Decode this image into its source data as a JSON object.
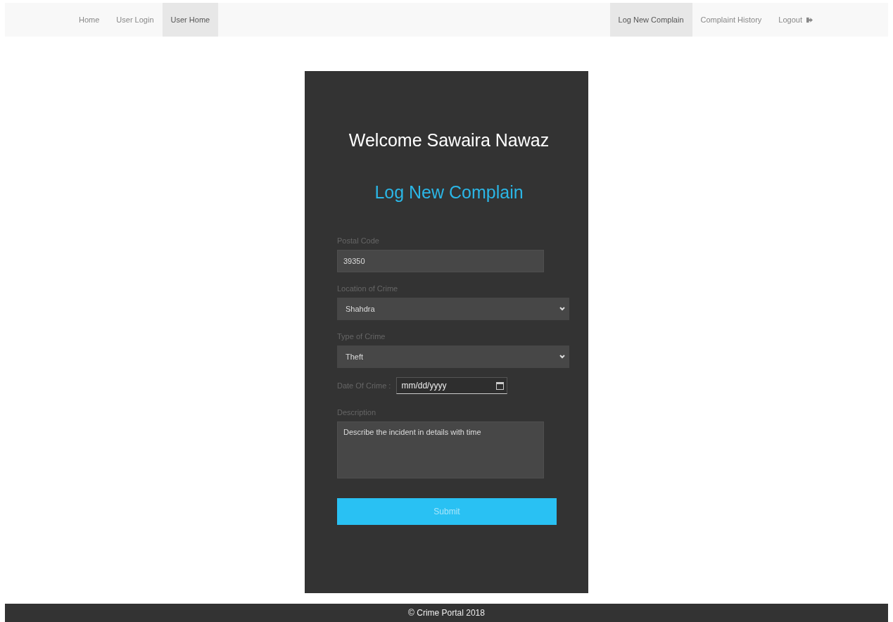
{
  "nav": {
    "left": [
      {
        "label": "Home",
        "selected": false
      },
      {
        "label": "User Login",
        "selected": false
      },
      {
        "label": "User Home",
        "selected": true
      }
    ],
    "right": [
      {
        "label": "Log New Complain",
        "selected": true
      },
      {
        "label": "Complaint History",
        "selected": false
      },
      {
        "label": "Logout",
        "selected": false,
        "kind": "logout"
      }
    ]
  },
  "card": {
    "welcome": "Welcome Sawaira Nawaz",
    "heading": "Log New Complain",
    "fields": [
      {
        "kind": "text",
        "label": "Postal Code",
        "value": "39350"
      },
      {
        "kind": "select",
        "label": "Location of Crime",
        "value": "Shahdra"
      },
      {
        "kind": "select",
        "label": "Type of Crime",
        "value": "Theft"
      },
      {
        "kind": "date",
        "label": "Date Of Crime :",
        "placeholder": "mm/dd/yyyy"
      },
      {
        "kind": "textarea",
        "label": "Description",
        "placeholder": "Describe the incident in details with time"
      }
    ],
    "submit": "Submit"
  },
  "footer": "© Crime Portal 2018"
}
